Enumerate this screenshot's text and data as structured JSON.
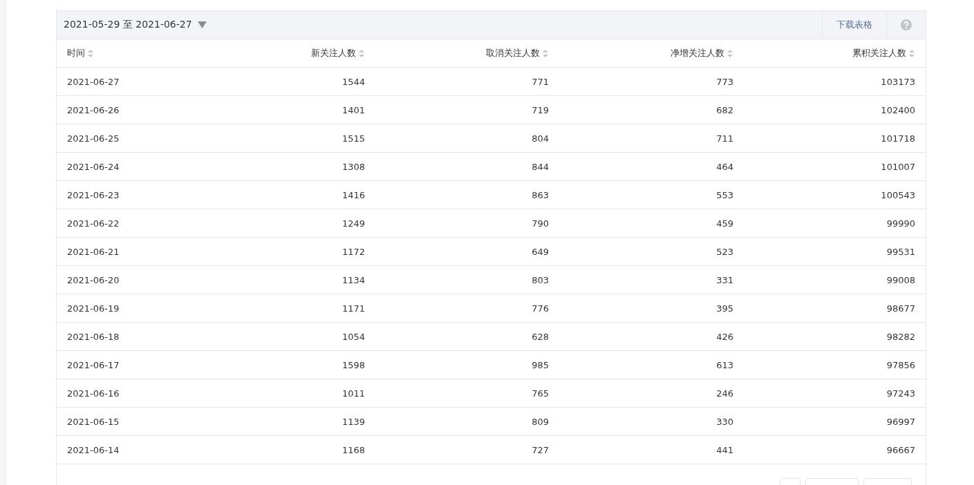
{
  "toolbar": {
    "date_range": "2021-05-29 至 2021-06-27",
    "download": "下载表格"
  },
  "table": {
    "columns": [
      "时间",
      "新关注人数",
      "取消关注人数",
      "净增关注人数",
      "累积关注人数"
    ],
    "rows": [
      [
        "2021-06-27",
        "1544",
        "771",
        "773",
        "103173"
      ],
      [
        "2021-06-26",
        "1401",
        "719",
        "682",
        "102400"
      ],
      [
        "2021-06-25",
        "1515",
        "804",
        "711",
        "101718"
      ],
      [
        "2021-06-24",
        "1308",
        "844",
        "464",
        "101007"
      ],
      [
        "2021-06-23",
        "1416",
        "863",
        "553",
        "100543"
      ],
      [
        "2021-06-22",
        "1249",
        "790",
        "459",
        "99990"
      ],
      [
        "2021-06-21",
        "1172",
        "649",
        "523",
        "99531"
      ],
      [
        "2021-06-20",
        "1134",
        "803",
        "331",
        "99008"
      ],
      [
        "2021-06-19",
        "1171",
        "776",
        "395",
        "98677"
      ],
      [
        "2021-06-18",
        "1054",
        "628",
        "426",
        "98282"
      ],
      [
        "2021-06-17",
        "1598",
        "985",
        "613",
        "97856"
      ],
      [
        "2021-06-16",
        "1011",
        "765",
        "246",
        "97243"
      ],
      [
        "2021-06-15",
        "1139",
        "809",
        "330",
        "96997"
      ],
      [
        "2021-06-14",
        "1168",
        "727",
        "441",
        "96667"
      ]
    ]
  }
}
